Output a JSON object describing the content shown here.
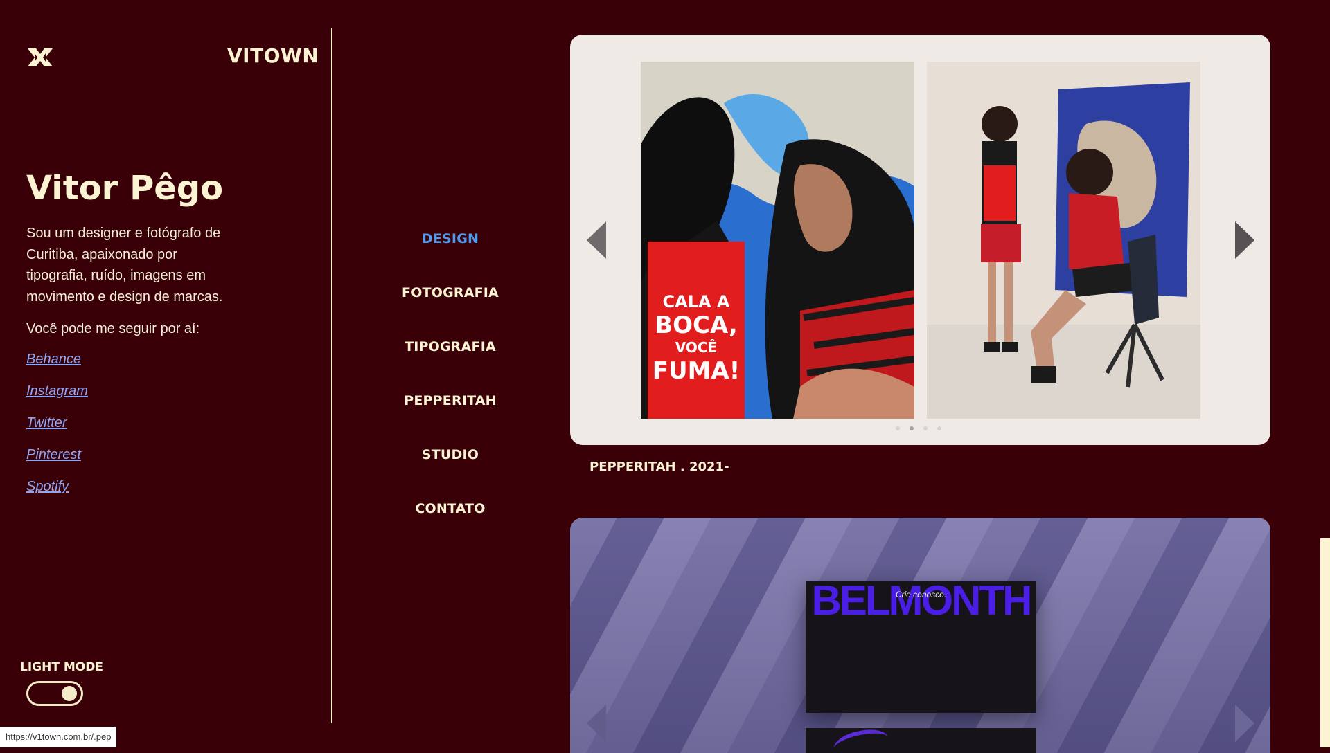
{
  "brand": {
    "logo_icon": "x-logo-icon",
    "name": "VITOWN"
  },
  "profile": {
    "name": "Vitor Pêgo",
    "bio": "Sou um designer e fotógrafo de Curitiba, apaixonado por tipografia, ruído, imagens em movimento e design de marcas.",
    "follow_text": "Você pode me seguir por aí:",
    "links": [
      "Behance",
      "Instagram",
      "Twitter",
      "Pinterest",
      "Spotify"
    ]
  },
  "theme": {
    "label": "LIGHT MODE",
    "toggle_on": true
  },
  "nav": {
    "items": [
      "DESIGN",
      "FOTOGRAFIA",
      "TIPOGRAFIA",
      "PEPPERITAH",
      "STUDIO",
      "CONTATO"
    ],
    "active": "DESIGN"
  },
  "projects": [
    {
      "caption": "PEPPERITAH . 2021-",
      "bag_text": "CALA A BOCA, VOCÊ FUMA!",
      "slide_count": 4,
      "active_slide": 2
    },
    {
      "screen_title": "BELMONTH",
      "screen_tagline": "Crie conosco."
    }
  ],
  "status_bar": {
    "url": "https://v1town.com.br/.pep"
  },
  "colors": {
    "background": "#3a0008",
    "text": "#fbf3d2",
    "active_nav": "#4f9bf0",
    "link": "#8ea6f6",
    "card": "#efeae6"
  }
}
